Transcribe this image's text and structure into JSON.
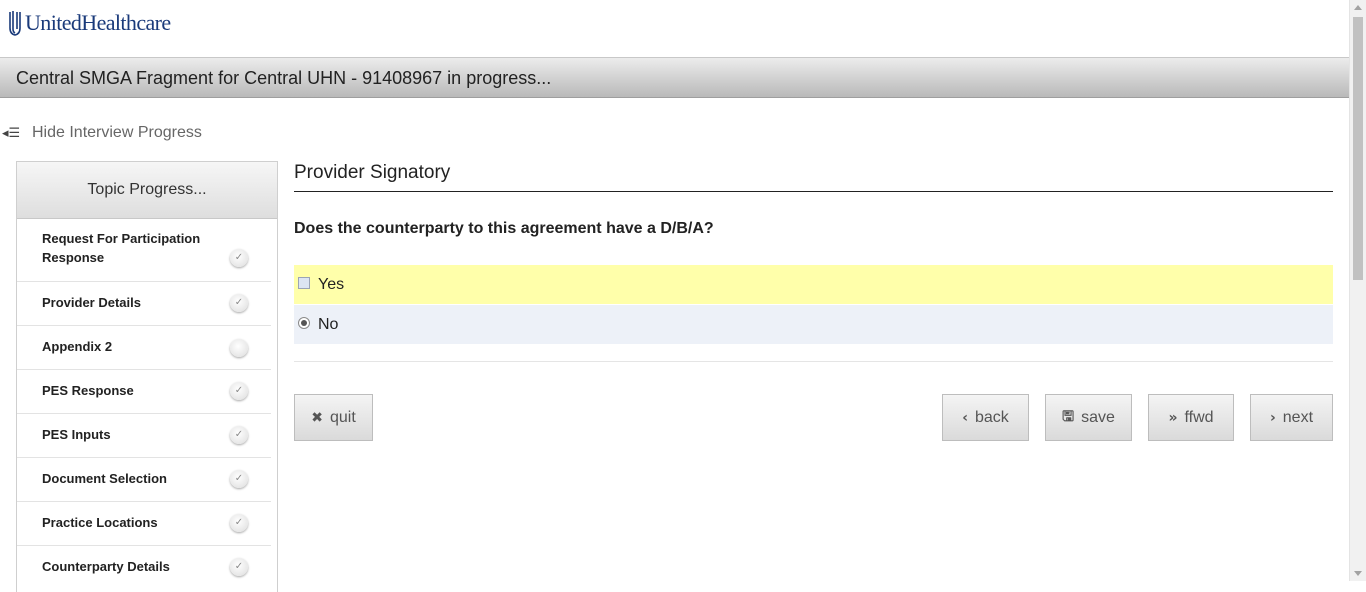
{
  "brand": {
    "name": "UnitedHealthcare",
    "color": "#1a3a7a"
  },
  "title_bar": {
    "title": "Central SMGA Fragment for Central UHN - 91408967 in progress..."
  },
  "progress_toggle": {
    "label": "Hide Interview Progress",
    "icon": "list-collapse-icon"
  },
  "sidebar": {
    "heading": "Topic Progress...",
    "items": [
      {
        "label": "Request For Participation Response",
        "status": "complete"
      },
      {
        "label": "Provider Details",
        "status": "complete"
      },
      {
        "label": "Appendix 2",
        "status": "incomplete"
      },
      {
        "label": "PES Response",
        "status": "complete"
      },
      {
        "label": "PES Inputs",
        "status": "complete"
      },
      {
        "label": "Document Selection",
        "status": "complete"
      },
      {
        "label": "Practice Locations",
        "status": "complete"
      },
      {
        "label": "Counterparty Details",
        "status": "complete"
      }
    ]
  },
  "main": {
    "title": "Provider Signatory",
    "question": "Does the counterparty to this agreement have a D/B/A?",
    "options": [
      {
        "label": "Yes",
        "selected": false,
        "highlight_color": "#ffffaa"
      },
      {
        "label": "No",
        "selected": true
      }
    ]
  },
  "buttons": {
    "quit": "quit",
    "back": "back",
    "save": "save",
    "ffwd": "ffwd",
    "next": "next"
  }
}
